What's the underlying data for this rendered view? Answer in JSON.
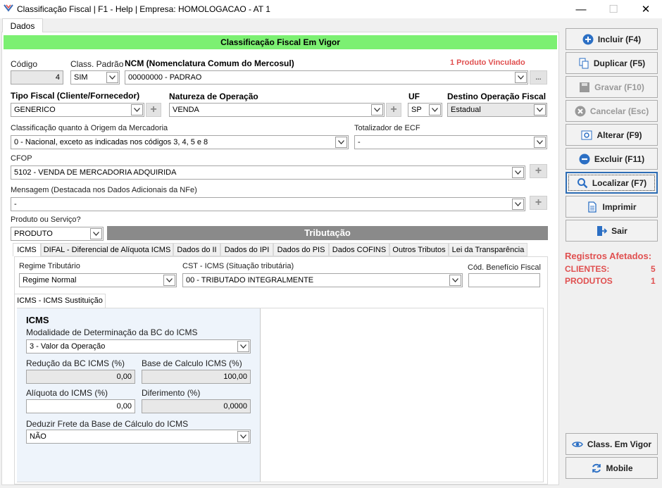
{
  "window": {
    "title": "Classificação Fiscal | F1 - Help | Empresa: HOMOLOGACAO - AT 1",
    "minimize": "—",
    "maximize": "☐",
    "close": "✕"
  },
  "tabs": {
    "main": "Dados"
  },
  "banner": "Classificação Fiscal Em Vigor",
  "form": {
    "codigo_label": "Código",
    "codigo_value": "4",
    "class_padrao_label": "Class. Padrão",
    "class_padrao_value": "SIM",
    "ncm_label": "NCM (Nomenclatura Comum do Mercosul)",
    "ncm_value": "00000000 - PADRAO",
    "ncm_link": "1 Produto Vinculado",
    "ncm_ellipsis": "...",
    "tipo_fiscal_label": "Tipo Fiscal (Cliente/Fornecedor)",
    "tipo_fiscal_value": "GENERICO",
    "natureza_label": "Natureza de Operação",
    "natureza_value": "VENDA",
    "uf_label": "UF",
    "uf_value": "SP",
    "destino_label": "Destino Operação Fiscal",
    "destino_value": "Estadual",
    "origem_label": "Classificação quanto à Origem da Mercadoria",
    "origem_value": "0 - Nacional, exceto as indicadas nos códigos 3, 4, 5 e 8",
    "ecf_label": "Totalizador de ECF",
    "ecf_value": "-",
    "cfop_label": "CFOP",
    "cfop_value": "5102 - VENDA DE MERCADORIA ADQUIRIDA",
    "mensagem_label": "Mensagem (Destacada nos Dados Adicionais da NFe)",
    "mensagem_value": "-",
    "produto_label": "Produto ou Serviço?",
    "produto_value": "PRODUTO",
    "plus": "+"
  },
  "tributacao": {
    "header": "Tributação",
    "tabs": [
      "ICMS",
      "DIFAL - Diferencial de Alíquota ICMS",
      "Dados do II",
      "Dados do IPI",
      "Dados do PIS",
      "Dados COFINS",
      "Outros Tributos",
      "Lei da Transparência"
    ],
    "regime_label": "Regime Tributário",
    "regime_value": "Regime Normal",
    "cst_label": "CST - ICMS (Situação tributária)",
    "cst_value": "00 - TRIBUTADO INTEGRALMENTE",
    "beneficio_label": "Cód. Benefício Fiscal",
    "beneficio_value": "",
    "subtab": "ICMS - ICMS Sustituição",
    "icms": {
      "heading": "ICMS",
      "modalidade_label": "Modalidade de Determinação da BC do ICMS",
      "modalidade_value": "3 - Valor da Operação",
      "reducao_label": "Redução da BC ICMS (%)",
      "reducao_value": "0,00",
      "base_label": "Base de Calculo ICMS (%)",
      "base_value": "100,00",
      "aliquota_label": "Alíquota do ICMS (%)",
      "aliquota_value": "0,00",
      "diferimento_label": "Diferimento (%)",
      "diferimento_value": "0,0000",
      "frete_label": "Deduzir Frete da Base de Cálculo do ICMS",
      "frete_value": "NÃO"
    }
  },
  "sidebar": {
    "buttons": {
      "incluir": "Incluir (F4)",
      "duplicar": "Duplicar (F5)",
      "gravar": "Gravar (F10)",
      "cancelar": "Cancelar (Esc)",
      "alterar": "Alterar (F9)",
      "excluir": "Excluir (F11)",
      "localizar": "Localizar (F7)",
      "imprimir": "Imprimir",
      "sair": "Sair",
      "class_vigor": "Class. Em Vigor",
      "mobile": "Mobile"
    },
    "registros": {
      "title": "Registros Afetados:",
      "clientes_label": "CLIENTES:",
      "clientes_value": "5",
      "produtos_label": "PRODUTOS",
      "produtos_value": "1"
    }
  },
  "colors": {
    "banner": "#7cf072",
    "accent_red": "#e05050",
    "focus": "#2d6db5"
  }
}
